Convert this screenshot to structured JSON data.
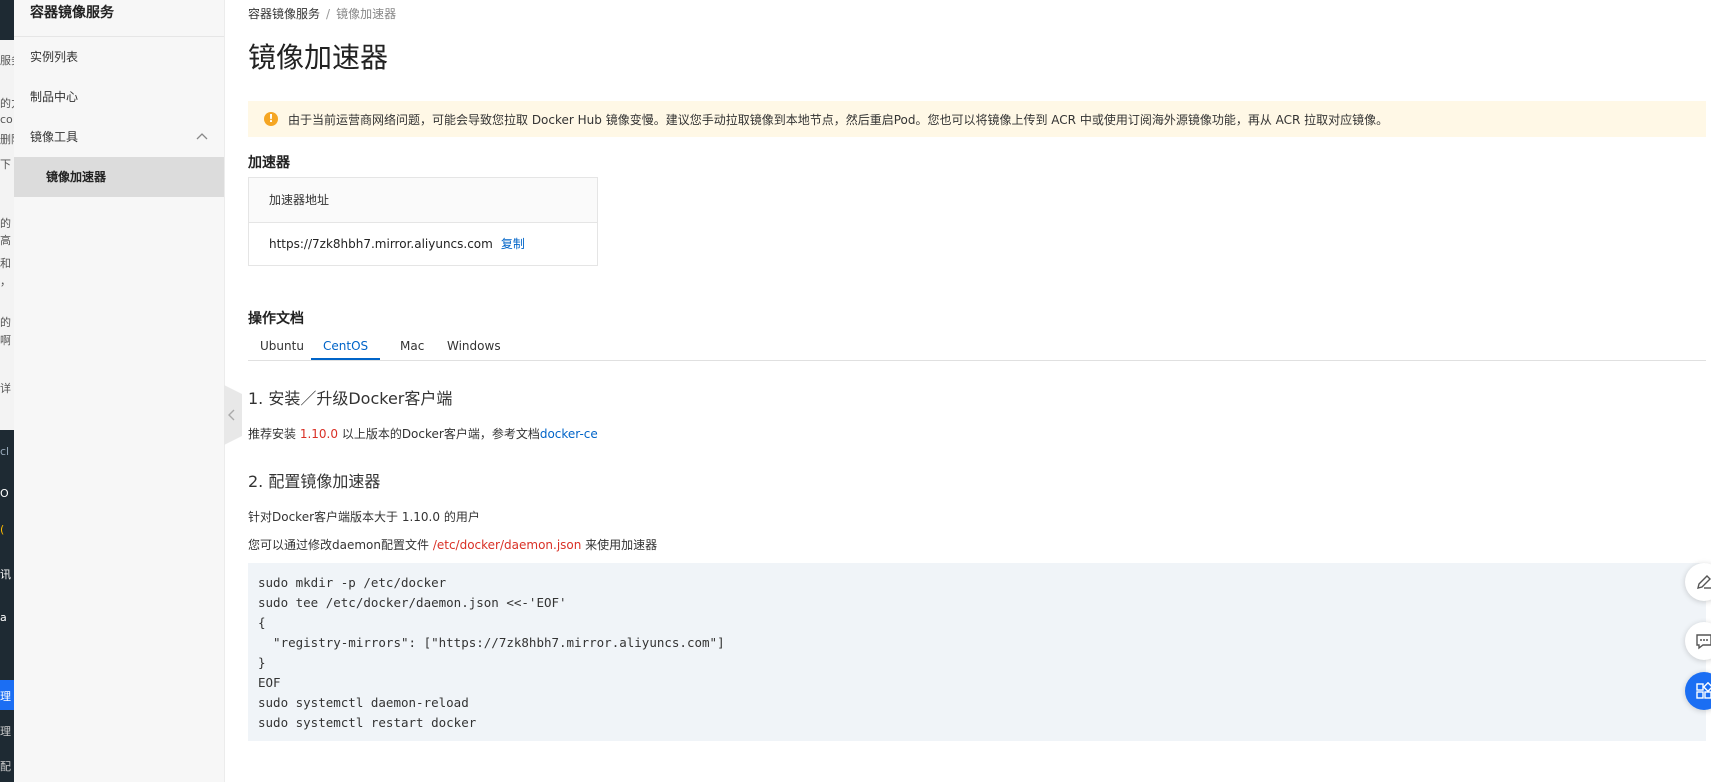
{
  "background_fragments": [
    "服务",
    "的力",
    "co",
    "删除",
    "下",
    "的",
    "高",
    "和",
    "，",
    "的",
    "啊",
    "详",
    "cl",
    "O",
    "(",
    "讯",
    "a",
    "理",
    "理",
    "配"
  ],
  "sidebar": {
    "title": "容器镜像服务",
    "items": [
      {
        "label": "实例列表"
      },
      {
        "label": "制品中心"
      },
      {
        "label": "镜像工具"
      }
    ],
    "subitems": [
      {
        "label": "镜像加速器",
        "active": true
      }
    ]
  },
  "breadcrumb": {
    "items": [
      "容器镜像服务",
      "镜像加速器"
    ],
    "separator": "/"
  },
  "page_title": "镜像加速器",
  "notice": {
    "icon": "warning-icon",
    "text": "由于当前运营商网络问题，可能会导致您拉取 Docker Hub 镜像变慢。建议您手动拉取镜像到本地节点，然后重启Pod。您也可以将镜像上传到 ACR 中或使用订阅海外源镜像功能，再从 ACR 拉取对应镜像。"
  },
  "accelerator": {
    "heading": "加速器",
    "column_header": "加速器地址",
    "address": "https://7zk8hbh7.mirror.aliyuncs.com",
    "copy_label": "复制"
  },
  "docs": {
    "heading": "操作文档",
    "tabs": [
      {
        "label": "Ubuntu"
      },
      {
        "label": "CentOS",
        "active": true
      },
      {
        "label": "Mac"
      },
      {
        "label": "Windows"
      }
    ],
    "step1_title": "1. 安装／升级Docker客户端",
    "step1_text_prefix": "推荐安装 ",
    "step1_version": "1.10.0",
    "step1_text_mid": " 以上版本的Docker客户端，参考文档",
    "step1_link": "docker-ce",
    "step2_title": "2. 配置镜像加速器",
    "step2_line1": "针对Docker客户端版本大于 1.10.0 的用户",
    "step2_line2_prefix": "您可以通过修改daemon配置文件 ",
    "step2_path": "/etc/docker/daemon.json",
    "step2_line2_suffix": " 来使用加速器",
    "code": "sudo mkdir -p /etc/docker\nsudo tee /etc/docker/daemon.json <<-'EOF'\n{\n  \"registry-mirrors\": [\"https://7zk8hbh7.mirror.aliyuncs.com\"]\n}\nEOF\nsudo systemctl daemon-reload\nsudo systemctl restart docker"
  },
  "floating_buttons": [
    {
      "icon": "edit-icon"
    },
    {
      "icon": "chat-icon"
    },
    {
      "icon": "apps-icon"
    }
  ],
  "colors": {
    "link": "#0064c8",
    "highlight_red": "#d93026",
    "notice_bg": "#fff8e6",
    "warning": "#f5a623",
    "fab_blue": "#1b6ef3"
  }
}
